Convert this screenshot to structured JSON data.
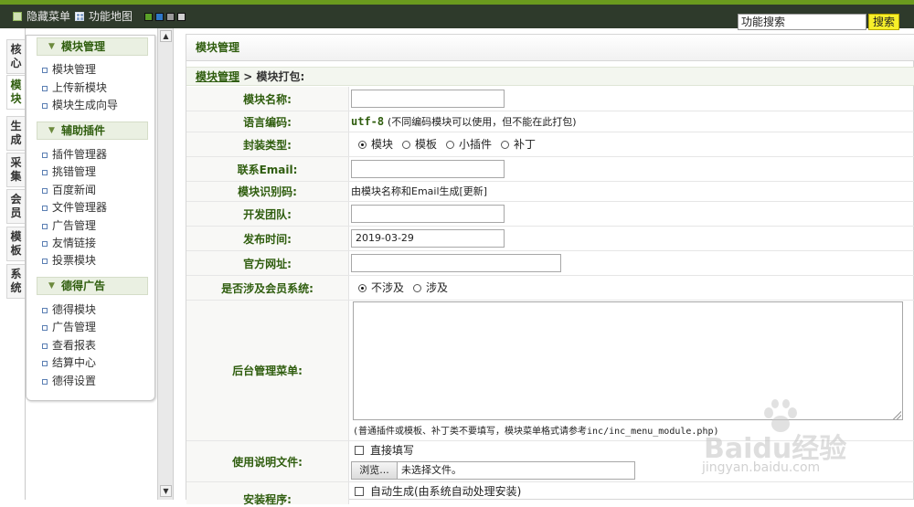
{
  "topbar": {
    "hide_menu_label": "隐藏菜单",
    "func_map_label": "功能地图",
    "skin_colors": [
      "#5aa028",
      "#2f78c8",
      "#9a9a9a",
      "#cfcfcf"
    ],
    "search_value": "功能搜索",
    "search_button": "搜索"
  },
  "vtabs": [
    {
      "label": "核心",
      "active": false
    },
    {
      "label": "模块",
      "active": true
    },
    {
      "label": "生成",
      "active": false
    },
    {
      "label": "采集",
      "active": false
    },
    {
      "label": "会员",
      "active": false
    },
    {
      "label": "模板",
      "active": false
    },
    {
      "label": "系统",
      "active": false
    }
  ],
  "menu": {
    "group1": {
      "title": "模块管理",
      "items": [
        "模块管理",
        "上传新模块",
        "模块生成向导"
      ]
    },
    "group2": {
      "title": "辅助插件",
      "items": [
        "插件管理器",
        "挑错管理",
        "百度新闻",
        "文件管理器",
        "广告管理",
        "友情链接",
        "投票模块"
      ]
    },
    "group3": {
      "title": "德得广告",
      "items": [
        "德得模块",
        "广告管理",
        "查看报表",
        "结算中心",
        "德得设置"
      ]
    }
  },
  "main": {
    "header": "模块管理",
    "crumb_link": "模块管理",
    "crumb_sep": " > ",
    "crumb_current": "模块打包:"
  },
  "form": {
    "name_label": "模块名称:",
    "name_value": "",
    "lang_label": "语言编码:",
    "lang_code": "utf-8",
    "lang_note": "(不同编码模块可以使用，但不能在此打包)",
    "pack_label": "封装类型:",
    "pack_options": [
      "模块",
      "模板",
      "小插件",
      "补丁"
    ],
    "pack_selected": "模块",
    "email_label": "联系Email:",
    "email_value": "",
    "ident_label": "模块识别码:",
    "ident_text": "由模块名称和Email生成[更新]",
    "team_label": "开发团队:",
    "team_value": "",
    "date_label": "发布时间:",
    "date_value": "2019-03-29",
    "site_label": "官方网址:",
    "site_value": "",
    "member_label": "是否涉及会员系统:",
    "member_options": [
      "不涉及",
      "涉及"
    ],
    "member_selected": "不涉及",
    "admin_menu_label": "后台管理菜单:",
    "admin_menu_value": "",
    "admin_menu_note": "(普通插件或模板、补丁类不要填写，模块菜单格式请参考inc/inc_menu_module.php)",
    "readme_label": "使用说明文件:",
    "readme_check": "直接填写",
    "browse_button": "浏览...",
    "file_status": "未选择文件。",
    "install_label": "安装程序:",
    "install_check": "自动生成(由系统自动处理安装)"
  },
  "watermark": {
    "brand": "Baidu经验",
    "url": "jingyan.baidu.com"
  }
}
